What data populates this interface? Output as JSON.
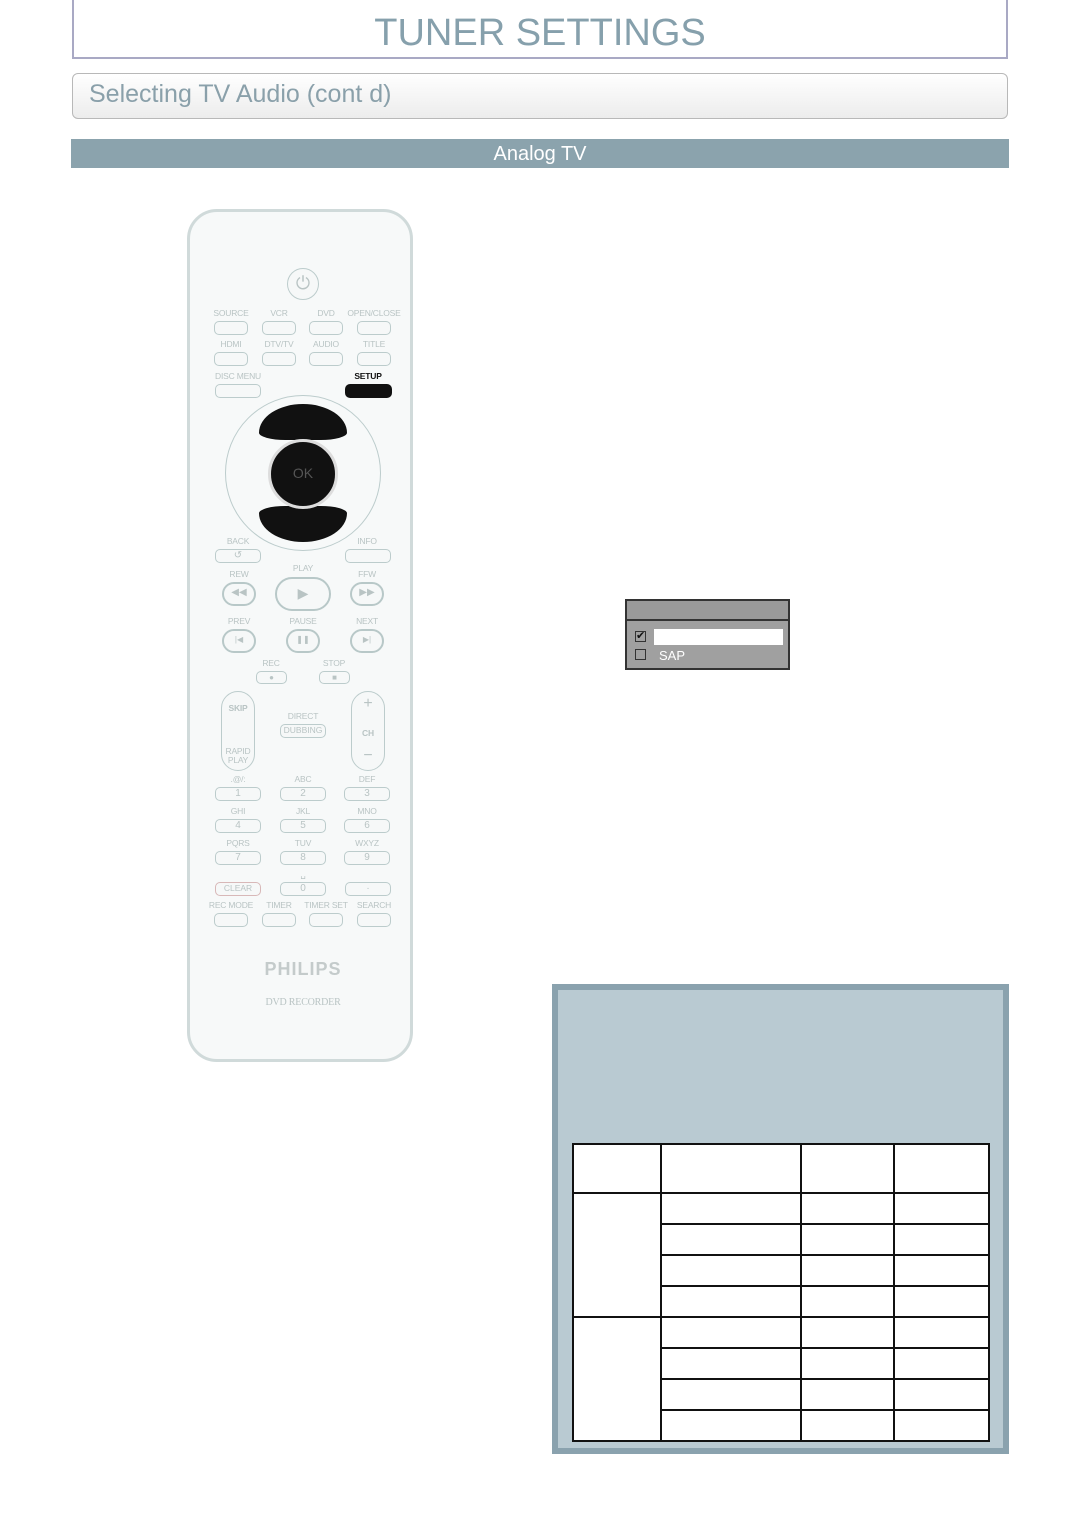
{
  "header": {
    "title": "TUNER SETTINGS",
    "subtitle": "Selecting TV Audio (cont d)",
    "section": "Analog TV"
  },
  "remote": {
    "row1": [
      "SOURCE",
      "VCR",
      "DVD",
      "OPEN/CLOSE"
    ],
    "row2": [
      "HDMI",
      "DTV/TV",
      "AUDIO",
      "TITLE"
    ],
    "disc_menu": "DISC MENU",
    "setup": "SETUP",
    "ok": "OK",
    "back": "BACK",
    "info": "INFO",
    "rew": "REW",
    "play": "PLAY",
    "ffw": "FFW",
    "prev": "PREV",
    "pause": "PAUSE",
    "next": "NEXT",
    "rec": "REC",
    "stop": "STOP",
    "skip": "SKIP",
    "rapid_play": "RAPID PLAY",
    "direct": "DIRECT",
    "dubbing": "DUBBING",
    "ch": "CH",
    "keypad": [
      {
        "letters": ".@/:",
        "num": "1"
      },
      {
        "letters": "ABC",
        "num": "2"
      },
      {
        "letters": "DEF",
        "num": "3"
      },
      {
        "letters": "GHI",
        "num": "4"
      },
      {
        "letters": "JKL",
        "num": "5"
      },
      {
        "letters": "MNO",
        "num": "6"
      },
      {
        "letters": "PQRS",
        "num": "7"
      },
      {
        "letters": "TUV",
        "num": "8"
      },
      {
        "letters": "WXYZ",
        "num": "9"
      }
    ],
    "clear": "CLEAR",
    "zero": "0",
    "dot": "·",
    "space_symbol": "␣",
    "row_bottom": [
      "REC MODE",
      "TIMER",
      "TIMER SET",
      "SEARCH"
    ],
    "brand": "PHILIPS",
    "model": "DVD RECORDER"
  },
  "osd": {
    "options": [
      {
        "label": "",
        "checked": true
      },
      {
        "label": "SAP",
        "checked": false
      }
    ]
  },
  "colors": {
    "accent": "#8ba3ad",
    "panel": "#b9cad2",
    "title": "#86a0ac"
  }
}
